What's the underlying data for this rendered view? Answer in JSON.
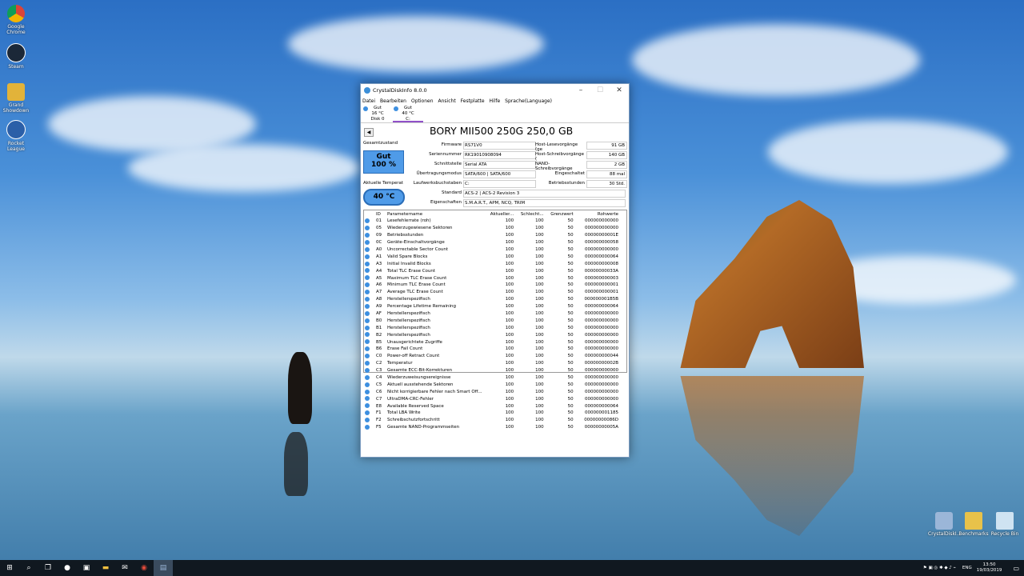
{
  "desktop": {
    "icons": [
      {
        "label": "Google Chrome"
      },
      {
        "label": "Steam"
      },
      {
        "label": "Grand Showdown"
      },
      {
        "label": "Rocket League"
      }
    ],
    "bottom_icons": [
      {
        "label": "CrystalDiskI..."
      },
      {
        "label": "Benchmarks"
      },
      {
        "label": "Recycle Bin"
      }
    ]
  },
  "window": {
    "title": "CrystalDiskInfo 8.0.0",
    "menu": [
      "Datei",
      "Bearbeiten",
      "Optionen",
      "Ansicht",
      "Festplatte",
      "Hilfe",
      "Sprache(Language)"
    ],
    "disks": [
      {
        "status": "Gut",
        "temp": "16 °C",
        "name": "Disk 0"
      },
      {
        "status": "Gut",
        "temp": "40 °C",
        "name": "C:"
      }
    ],
    "model": "BORY MII500 250G 250,0 GB",
    "health_label": "Gesamtzustand",
    "health_status": "Gut",
    "health_percent": "100 %",
    "temp_label": "Aktuelle Temperat",
    "temp_value": "40 °C",
    "fields_left": [
      {
        "label": "Firmware",
        "value": "RS71V0"
      },
      {
        "label": "Seriennummer",
        "value": "RK19010908094"
      },
      {
        "label": "Schnittstelle",
        "value": "Serial ATA"
      },
      {
        "label": "Übertragungsmodus",
        "value": "SATA/600 | SATA/600"
      },
      {
        "label": "Laufwerksbuchstaben",
        "value": "C:"
      }
    ],
    "fields_right": [
      {
        "label": "Host-Lesevorgänge (ge",
        "value": "91 GB"
      },
      {
        "label": "Host-Schreibvorgänge (",
        "value": "140 GB"
      },
      {
        "label": "NAND-Schreibvorgänge",
        "value": "2 GB"
      },
      {
        "label": "Eingeschaltet",
        "value": "88 mal"
      },
      {
        "label": "Betriebsstunden",
        "value": "30 Std."
      }
    ],
    "standard_label": "Standard",
    "standard_value": "ACS-2 | ACS-2 Revision 3",
    "features_label": "Eigenschaften",
    "features_value": "S.M.A.R.T., APM, NCQ, TRIM",
    "table_headers": [
      "ID",
      "Parametername",
      "Aktueller...",
      "Schlecht...",
      "Grenzwert",
      "Rohwerte"
    ],
    "rows": [
      [
        "01",
        "Lesefehlerrate (roh)",
        "100",
        "100",
        "50",
        "000000000000"
      ],
      [
        "05",
        "Wiederzugewiesene Sektoren",
        "100",
        "100",
        "50",
        "000000000000"
      ],
      [
        "09",
        "Betriebsstunden",
        "100",
        "100",
        "50",
        "00000000001E"
      ],
      [
        "0C",
        "Geräte-Einschaltvorgänge",
        "100",
        "100",
        "50",
        "000000000058"
      ],
      [
        "A0",
        "Uncorrectable Sector Count",
        "100",
        "100",
        "50",
        "000000000000"
      ],
      [
        "A1",
        "Valid Spare Blocks",
        "100",
        "100",
        "50",
        "000000000064"
      ],
      [
        "A3",
        "Initial Invalid Blocks",
        "100",
        "100",
        "50",
        "000000000008"
      ],
      [
        "A4",
        "Total TLC Erase Count",
        "100",
        "100",
        "50",
        "00000000033A"
      ],
      [
        "A5",
        "Maximum TLC Erase Count",
        "100",
        "100",
        "50",
        "000000000003"
      ],
      [
        "A6",
        "Minimum TLC Erase Count",
        "100",
        "100",
        "50",
        "000000000001"
      ],
      [
        "A7",
        "Average TLC Erase Count",
        "100",
        "100",
        "50",
        "000000000001"
      ],
      [
        "A8",
        "Herstellerspezifisch",
        "100",
        "100",
        "50",
        "000000001B5B"
      ],
      [
        "A9",
        "Percentage Lifetime Remaining",
        "100",
        "100",
        "50",
        "000000000064"
      ],
      [
        "AF",
        "Herstellerspezifisch",
        "100",
        "100",
        "50",
        "000000000000"
      ],
      [
        "B0",
        "Herstellerspezifisch",
        "100",
        "100",
        "50",
        "000000000000"
      ],
      [
        "B1",
        "Herstellerspezifisch",
        "100",
        "100",
        "50",
        "000000000000"
      ],
      [
        "B2",
        "Herstellerspezifisch",
        "100",
        "100",
        "50",
        "000000000000"
      ],
      [
        "B5",
        "Unausgerichtete Zugriffe",
        "100",
        "100",
        "50",
        "000000000000"
      ],
      [
        "B6",
        "Erase Fail Count",
        "100",
        "100",
        "50",
        "000000000000"
      ],
      [
        "C0",
        "Power-off Retract Count",
        "100",
        "100",
        "50",
        "000000000044"
      ],
      [
        "C2",
        "Temperatur",
        "100",
        "100",
        "50",
        "00000000002B"
      ],
      [
        "C3",
        "Gesamte ECC-Bit-Korrekturen",
        "100",
        "100",
        "50",
        "000000000000"
      ],
      [
        "C4",
        "Wiederzuweisungsereignisse",
        "100",
        "100",
        "50",
        "000000000000"
      ],
      [
        "C5",
        "Aktuell ausstehende Sektoren",
        "100",
        "100",
        "50",
        "000000000000"
      ],
      [
        "C6",
        "Nicht korrigierbare Fehler nach Smart Off...",
        "100",
        "100",
        "50",
        "000000000000"
      ],
      [
        "C7",
        "UltraDMA-CRC-Fehler",
        "100",
        "100",
        "50",
        "000000000000"
      ],
      [
        "E8",
        "Available Reserved Space",
        "100",
        "100",
        "50",
        "000000000064"
      ],
      [
        "F1",
        "Total LBA Write",
        "100",
        "100",
        "50",
        "000000001185"
      ],
      [
        "F2",
        "Schreibschutzfortschritt",
        "100",
        "100",
        "50",
        "00000000086D"
      ],
      [
        "F5",
        "Gesamte NAND-Programmseiten",
        "100",
        "100",
        "50",
        "00000000005A"
      ]
    ]
  },
  "taskbar": {
    "language": "ENG",
    "time": "13:50",
    "date": "19/03/2019"
  },
  "colors": {
    "status_good": "#4f9be8",
    "taskbar": "#101820"
  }
}
